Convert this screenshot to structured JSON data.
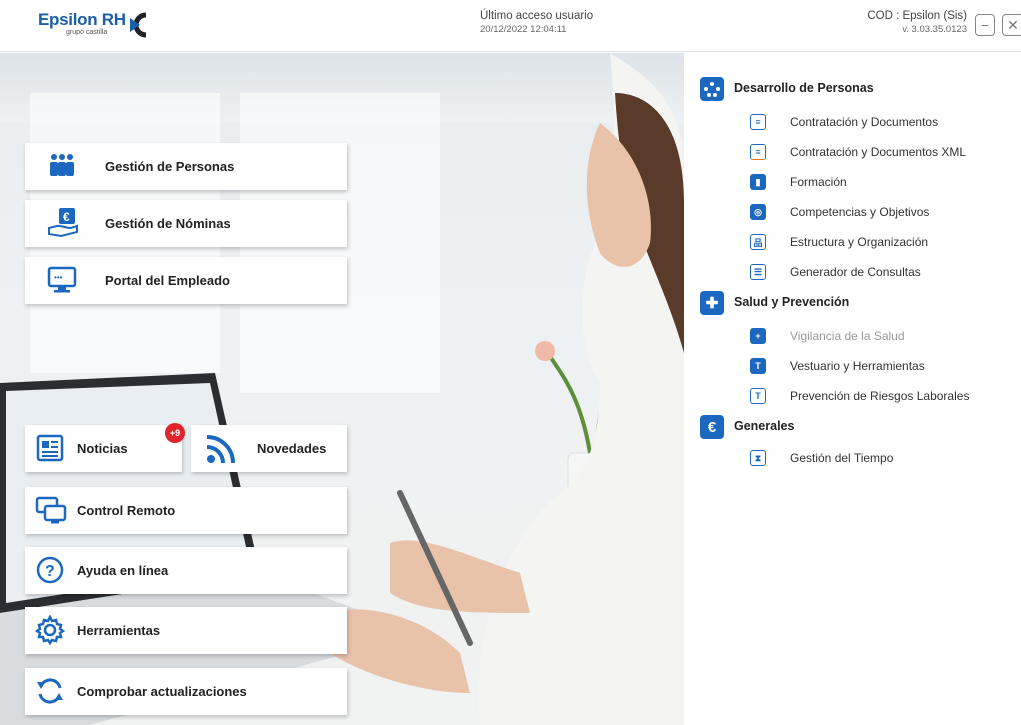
{
  "header": {
    "logo_text": "Epsilon RH",
    "logo_sub": "grupo castilla",
    "access_label": "Último acceso usuario",
    "access_date": "20/12/2022 12:04:11",
    "cod_label": "COD : Epsilon (Sis)",
    "version": "v. 3.03.35.0123",
    "minimize_glyph": "−",
    "close_glyph": "✕"
  },
  "menu": {
    "gestion_personas": "Gestión de Personas",
    "gestion_nominas": "Gestión de Nóminas",
    "portal_empleado": "Portal del Empleado",
    "noticias": "Noticias",
    "noticias_badge": "+9",
    "novedades": "Novedades",
    "control_remoto": "Control Remoto",
    "ayuda": "Ayuda en línea",
    "herramientas": "Herramientas",
    "comprobar": "Comprobar actualizaciones"
  },
  "panel": {
    "desarrollo": {
      "label": "Desarrollo de Personas",
      "items": [
        "Contratación y Documentos",
        "Contratación y Documentos XML",
        "Formación",
        "Competencias y Objetivos",
        "Estructura y Organización",
        "Generador de Consultas"
      ]
    },
    "salud": {
      "label": "Salud y Prevención",
      "items": [
        "Vigilancia de la Salud",
        "Vestuario y Herramientas",
        "Prevención de Riesgos Laborales"
      ]
    },
    "generales": {
      "label": "Generales",
      "items": [
        "Gestión del Tiempo"
      ]
    }
  },
  "colors": {
    "brand_blue": "#1c68c0",
    "badge_red": "#e0242b"
  }
}
